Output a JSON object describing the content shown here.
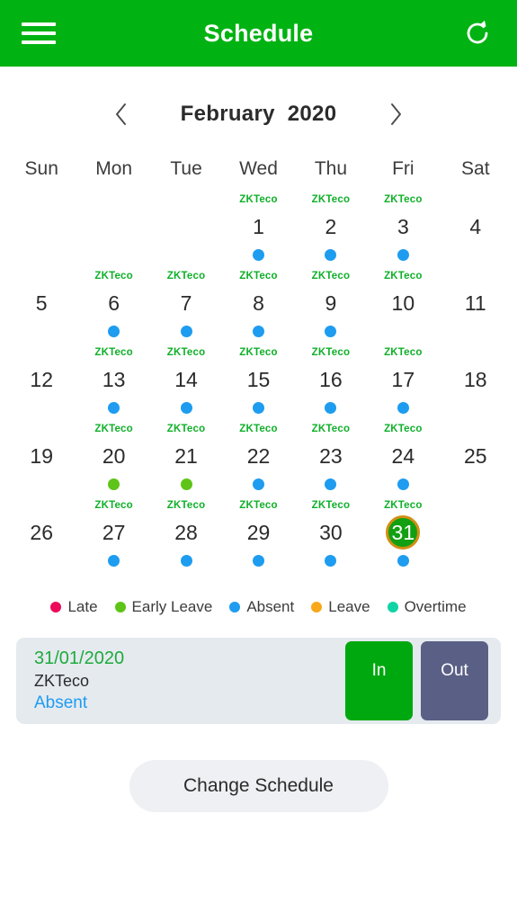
{
  "appbar": {
    "title": "Schedule",
    "menu_icon": "hamburger-menu-icon",
    "refresh_icon": "refresh-icon"
  },
  "month_nav": {
    "prev_icon": "chevron-left-icon",
    "next_icon": "chevron-right-icon",
    "month": "February",
    "year": "2020"
  },
  "calendar": {
    "day_headers": [
      "Sun",
      "Mon",
      "Tue",
      "Wed",
      "Thu",
      "Fri",
      "Sat"
    ],
    "selected_day": "31",
    "selected_ring_color": "#d28f14",
    "selected_fill_color": "#12a012",
    "shift_name": "ZKTeco",
    "weeks": [
      [
        {
          "day": "",
          "shift": "",
          "dot": ""
        },
        {
          "day": "",
          "shift": "",
          "dot": ""
        },
        {
          "day": "",
          "shift": "",
          "dot": ""
        },
        {
          "day": "1",
          "shift": "ZKTeco",
          "dot": "absent"
        },
        {
          "day": "2",
          "shift": "ZKTeco",
          "dot": "absent"
        },
        {
          "day": "3",
          "shift": "ZKTeco",
          "dot": "absent"
        },
        {
          "day": "4",
          "shift": "",
          "dot": ""
        }
      ],
      [
        {
          "day": "5",
          "shift": "",
          "dot": ""
        },
        {
          "day": "6",
          "shift": "ZKTeco",
          "dot": "absent"
        },
        {
          "day": "7",
          "shift": "ZKTeco",
          "dot": "absent"
        },
        {
          "day": "8",
          "shift": "ZKTeco",
          "dot": "absent"
        },
        {
          "day": "9",
          "shift": "ZKTeco",
          "dot": "absent"
        },
        {
          "day": "10",
          "shift": "ZKTeco",
          "dot": ""
        },
        {
          "day": "11",
          "shift": "",
          "dot": ""
        }
      ],
      [
        {
          "day": "12",
          "shift": "",
          "dot": ""
        },
        {
          "day": "13",
          "shift": "ZKTeco",
          "dot": "absent"
        },
        {
          "day": "14",
          "shift": "ZKTeco",
          "dot": "absent"
        },
        {
          "day": "15",
          "shift": "ZKTeco",
          "dot": "absent"
        },
        {
          "day": "16",
          "shift": "ZKTeco",
          "dot": "absent"
        },
        {
          "day": "17",
          "shift": "ZKTeco",
          "dot": "absent"
        },
        {
          "day": "18",
          "shift": "",
          "dot": ""
        }
      ],
      [
        {
          "day": "19",
          "shift": "",
          "dot": ""
        },
        {
          "day": "20",
          "shift": "ZKTeco",
          "dot": "early_leave"
        },
        {
          "day": "21",
          "shift": "ZKTeco",
          "dot": "early_leave"
        },
        {
          "day": "22",
          "shift": "ZKTeco",
          "dot": "absent"
        },
        {
          "day": "23",
          "shift": "ZKTeco",
          "dot": "absent"
        },
        {
          "day": "24",
          "shift": "ZKTeco",
          "dot": "absent"
        },
        {
          "day": "25",
          "shift": "",
          "dot": ""
        }
      ],
      [
        {
          "day": "26",
          "shift": "",
          "dot": ""
        },
        {
          "day": "27",
          "shift": "ZKTeco",
          "dot": "absent"
        },
        {
          "day": "28",
          "shift": "ZKTeco",
          "dot": "absent"
        },
        {
          "day": "29",
          "shift": "ZKTeco",
          "dot": "absent"
        },
        {
          "day": "30",
          "shift": "ZKTeco",
          "dot": "absent"
        },
        {
          "day": "31",
          "shift": "ZKTeco",
          "dot": "absent"
        },
        {
          "day": "",
          "shift": "",
          "dot": ""
        }
      ]
    ]
  },
  "legend": [
    {
      "key": "late",
      "label": "Late",
      "color": "#ec0a5a"
    },
    {
      "key": "early_leave",
      "label": "Early Leave",
      "color": "#5fc418"
    },
    {
      "key": "absent",
      "label": "Absent",
      "color": "#1e9cf0"
    },
    {
      "key": "leave",
      "label": "Leave",
      "color": "#f7a81b"
    },
    {
      "key": "overtime",
      "label": "Overtime",
      "color": "#11d4a6"
    }
  ],
  "detail_card": {
    "date": "31/01/2020",
    "shift": "ZKTeco",
    "status": "Absent",
    "punch_in_label": "In",
    "punch_out_label": "Out"
  },
  "footer": {
    "change_schedule_label": "Change Schedule"
  }
}
